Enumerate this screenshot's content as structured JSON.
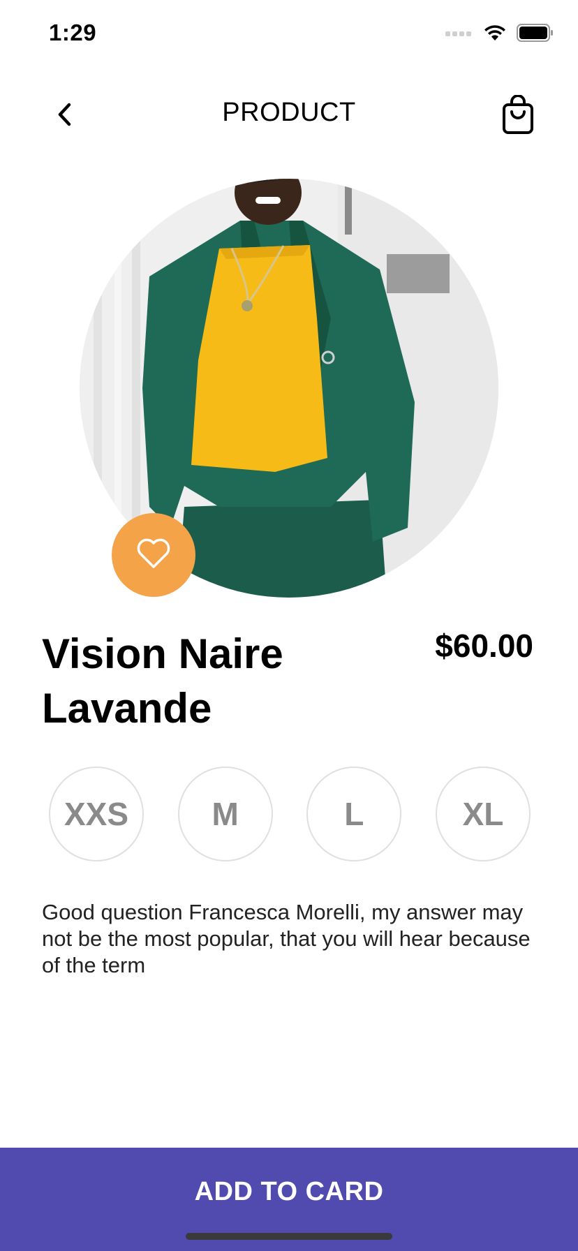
{
  "status_bar": {
    "time": "1:29"
  },
  "nav": {
    "title": "PRODUCT",
    "back_icon": "chevron-left-icon",
    "bag_icon": "shopping-bag-icon"
  },
  "product": {
    "name": "Vision Naire Lavande",
    "price": "$60.00",
    "favorite_icon": "heart-icon",
    "sizes": [
      {
        "label": "XXS"
      },
      {
        "label": "M"
      },
      {
        "label": "L"
      },
      {
        "label": "XL"
      }
    ],
    "description": "Good question Francesca Morelli, my answer may not be the most popular, that you will hear because of the term"
  },
  "cta": {
    "label": "ADD TO CARD"
  },
  "colors": {
    "accent": "#514bb0",
    "favorite": "#f5a349",
    "size_text": "#8a8a8a",
    "size_border": "#e0e0e0"
  }
}
